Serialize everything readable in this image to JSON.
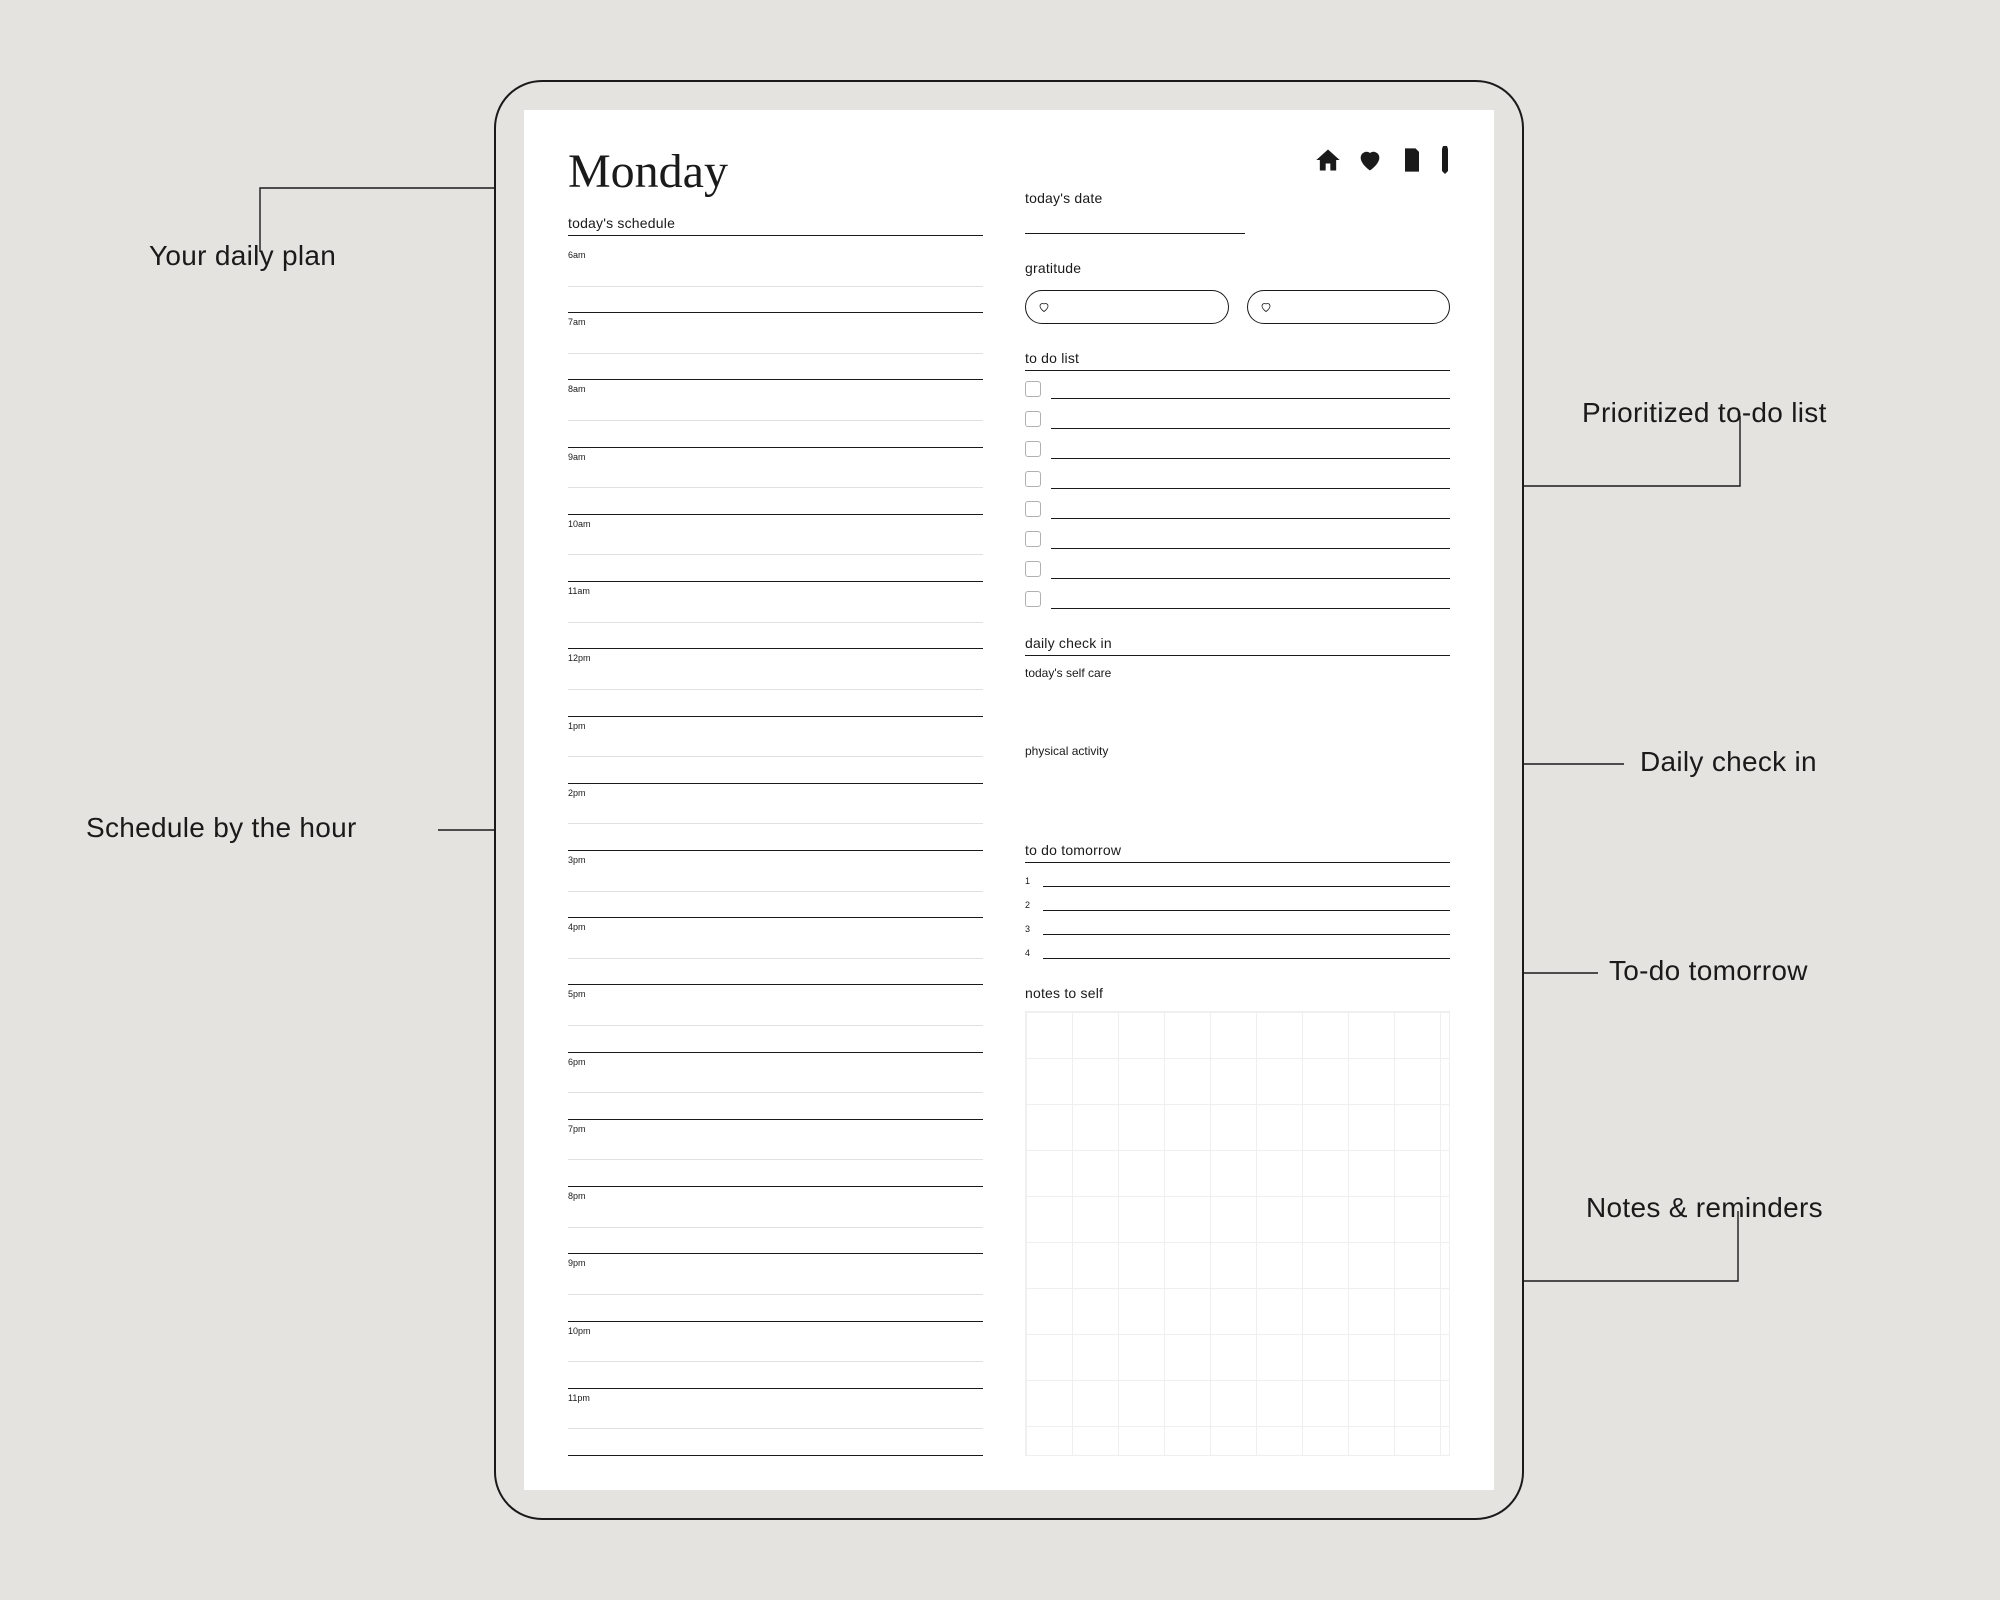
{
  "callouts": {
    "daily_plan": "Your daily plan",
    "schedule_hour": "Schedule by the hour",
    "priority_todo": "Prioritized to-do list",
    "daily_checkin": "Daily check in",
    "todo_tomorrow": "To-do tomorrow",
    "notes_reminders": "Notes & reminders"
  },
  "planner": {
    "day": "Monday",
    "schedule_label": "today's schedule",
    "hours": [
      "6am",
      "7am",
      "8am",
      "9am",
      "10am",
      "11am",
      "12pm",
      "1pm",
      "2pm",
      "3pm",
      "4pm",
      "5pm",
      "6pm",
      "7pm",
      "8pm",
      "9pm",
      "10pm",
      "11pm"
    ],
    "date_label": "today's date",
    "gratitude_label": "gratitude",
    "todo_label": "to do list",
    "todo_count": 8,
    "checkin_label": "daily check in",
    "checkin_selfcare": "today's self care",
    "checkin_physical": "physical activity",
    "tomorrow_label": "to do tomorrow",
    "tomorrow_nums": [
      "1",
      "2",
      "3",
      "4"
    ],
    "notes_label": "notes to self"
  }
}
